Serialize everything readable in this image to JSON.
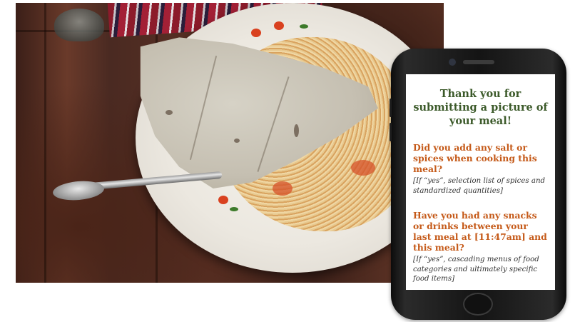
{
  "photo": {
    "description_icon": "meal-photo",
    "colors": {
      "table": "#5a3024",
      "plate": "#f4f2ec",
      "noodles": "#e2b577",
      "tortilla": "#c5bfb1"
    }
  },
  "phone": {
    "screen": {
      "title": "Thank you for submitting a picture of your meal!",
      "question_1": "Did you add any salt or spices when cooking this meal?",
      "note_1": "[If “yes”, selection list of spices and standardized quantities]",
      "question_2": "Have you had any snacks or drinks between your last meal at [11:47am] and this meal?",
      "note_2": "[If “yes”, cascading menus of food categories and ultimately specific food items]"
    },
    "colors": {
      "title": "#3c5a2a",
      "question": "#c55a19",
      "note": "#333333"
    }
  }
}
